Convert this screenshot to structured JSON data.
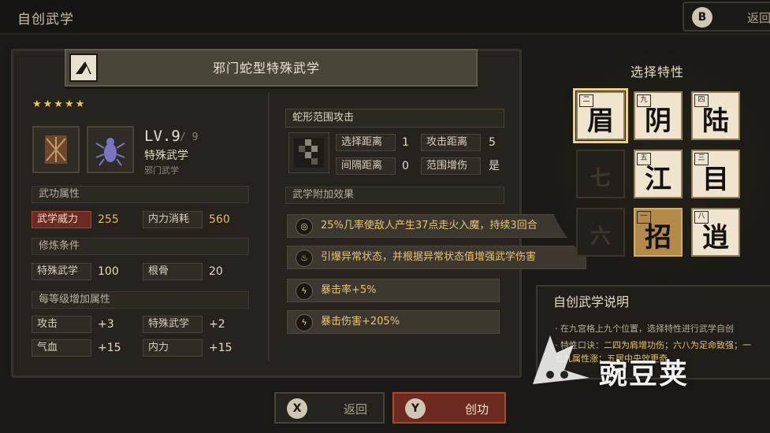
{
  "topbar": {
    "title": "自创武学",
    "back_key": "B",
    "back_label": "返回"
  },
  "skill": {
    "name": "邪门蛇型特殊武学",
    "stars": "★★★★★",
    "level": "LV.9",
    "level_max": "/ 9",
    "type": "特殊武学",
    "type_sub": "邪门武学"
  },
  "attributes": {
    "title": "武功属性",
    "power_label": "武学威力",
    "power_value": "255",
    "cost_label": "内力消耗",
    "cost_value": "560"
  },
  "requirements": {
    "title": "修炼条件",
    "items": [
      {
        "label": "特殊武学",
        "value": "100"
      },
      {
        "label": "根骨",
        "value": "20"
      }
    ]
  },
  "per_level": {
    "title": "每等级增加属性",
    "items": [
      {
        "label": "攻击",
        "value": "+3"
      },
      {
        "label": "特殊武学",
        "value": "+2"
      },
      {
        "label": "气血",
        "value": "+15"
      },
      {
        "label": "内力",
        "value": "+15"
      }
    ]
  },
  "range": {
    "title": "蛇形范围攻击",
    "select_dist_label": "选择距离",
    "select_dist_value": "1",
    "attack_dist_label": "攻击距离",
    "attack_dist_value": "5",
    "interval_label": "间隔距离",
    "interval_value": "0",
    "range_boost_label": "范围增伤",
    "range_boost_value": "是"
  },
  "effects": {
    "title": "武学附加效果",
    "items": [
      {
        "icon": "swirl-icon",
        "text": "25%几率使敌人产生37点走火入魔，持续3回合"
      },
      {
        "icon": "fire-icon",
        "text": "引爆异常状态，并根据异常状态值增强武学伤害"
      },
      {
        "icon": "lightning-icon",
        "text": "暴击率+5%"
      },
      {
        "icon": "lightning-icon",
        "text": "暴击伤害+205%"
      }
    ]
  },
  "traits": {
    "title": "选择特性",
    "tiles": [
      {
        "num": "二",
        "char": "眉",
        "state": "selected"
      },
      {
        "num": "九",
        "char": "阴",
        "state": "normal"
      },
      {
        "num": "四",
        "char": "陆",
        "state": "normal"
      },
      {
        "num": "",
        "char": "七",
        "state": "disabled"
      },
      {
        "num": "五",
        "char": "江",
        "state": "normal"
      },
      {
        "num": "三",
        "char": "目",
        "state": "normal"
      },
      {
        "num": "",
        "char": "六",
        "state": "disabled"
      },
      {
        "num": "一",
        "char": "招",
        "state": "active"
      },
      {
        "num": "八",
        "char": "逍",
        "state": "normal"
      }
    ]
  },
  "description": {
    "title": "自创武学说明",
    "line1": "· 在九宫格上九个位置，选择特性进行武学自创",
    "line2_prefix": "· 特性口诀：",
    "line2_highlight": "二四为肩增功伤；六八为足命致强；一",
    "line3": "七九属性涨；五居中央效更奇"
  },
  "watermark": {
    "text": "豌豆荚"
  },
  "buttons": {
    "back_key": "X",
    "back_label": "返回",
    "create_key": "Y",
    "create_label": "创功"
  },
  "colors": {
    "accent_gold": "#e8b95a",
    "danger_red": "#6b2a22",
    "tile_bg": "#efe5cf"
  }
}
